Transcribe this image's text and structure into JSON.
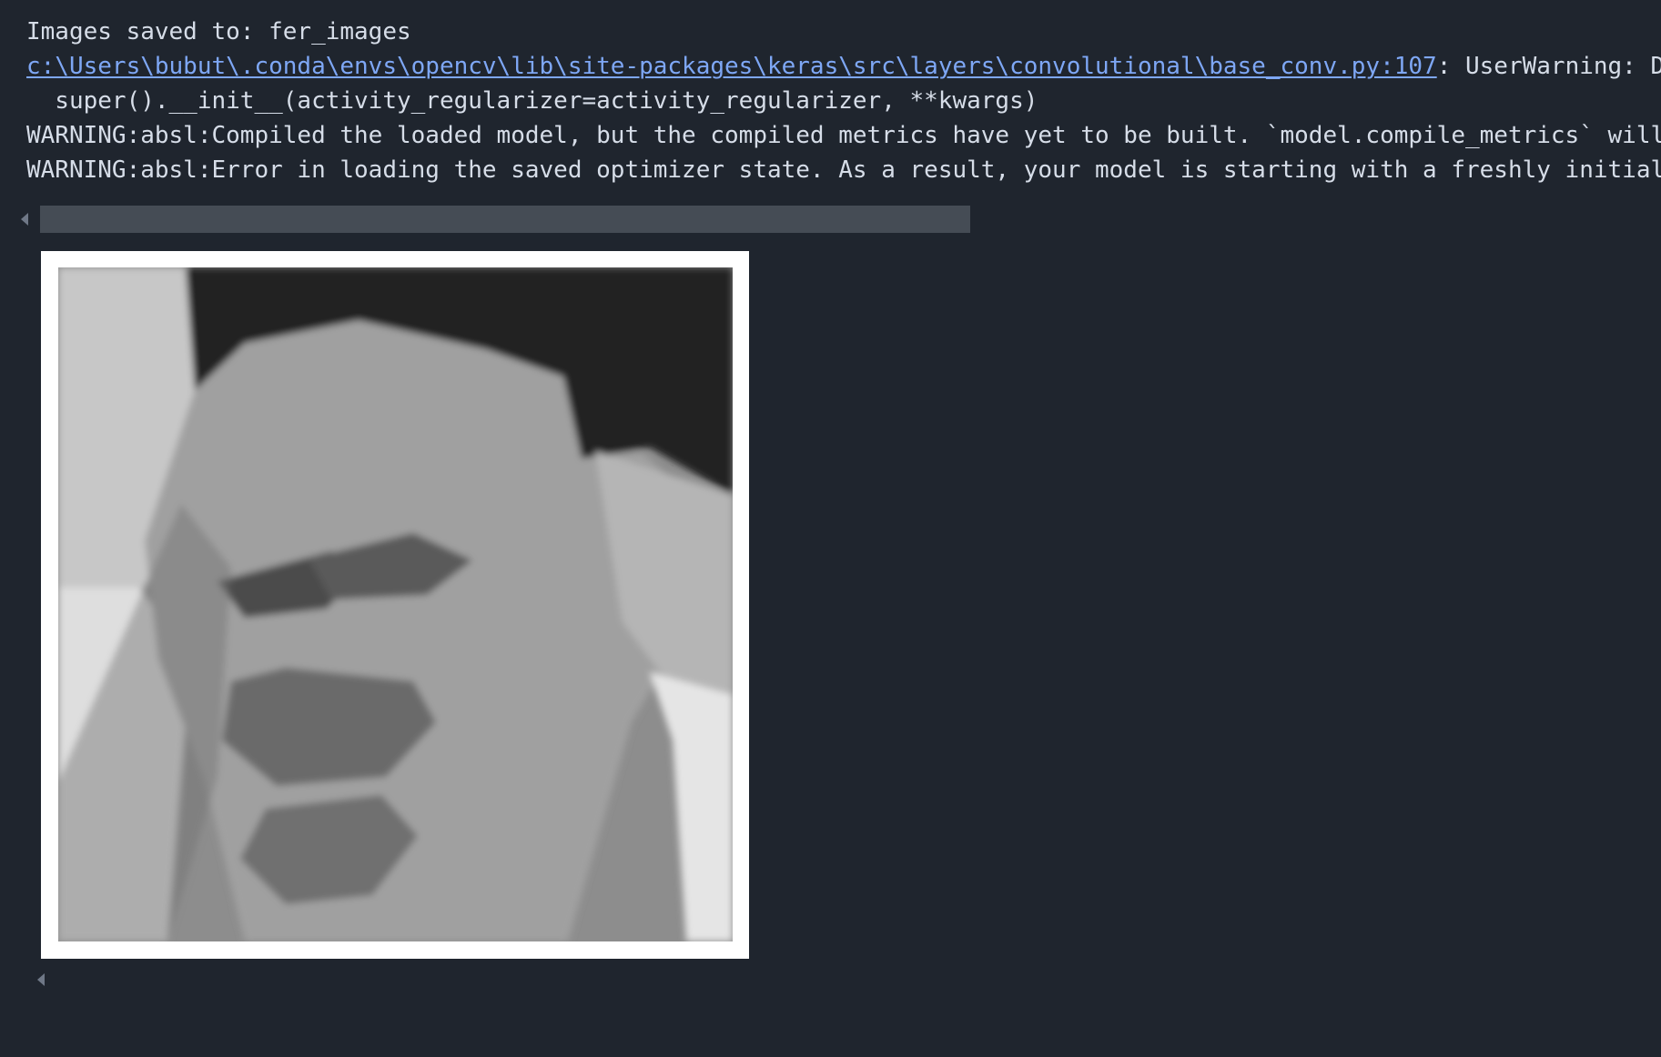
{
  "output": {
    "line_1": "Images saved to: fer_images",
    "warning_path": "c:\\Users\\bubut\\.conda\\envs\\opencv\\lib\\site-packages\\keras\\src\\layers\\convolutional\\base_conv.py:107",
    "warning_rest": ": UserWarning: Do",
    "line_3": "  super().__init__(activity_regularizer=activity_regularizer, **kwargs)",
    "line_4": "WARNING:absl:Compiled the loaded model, but the compiled metrics have yet to be built. `model.compile_metrics` will b",
    "line_5": "WARNING:absl:Error in loading the saved optimizer state. As a result, your model is starting with a freshly initializ"
  },
  "image": {
    "kind": "grayscale face photo",
    "background": "#ffffff"
  },
  "colors": {
    "background": "#1f252e",
    "text": "#d6dde8",
    "link": "#7ea7f5",
    "scrollbar": "#454c55"
  },
  "icons": {
    "scroll_left": "chevron-left-icon"
  }
}
